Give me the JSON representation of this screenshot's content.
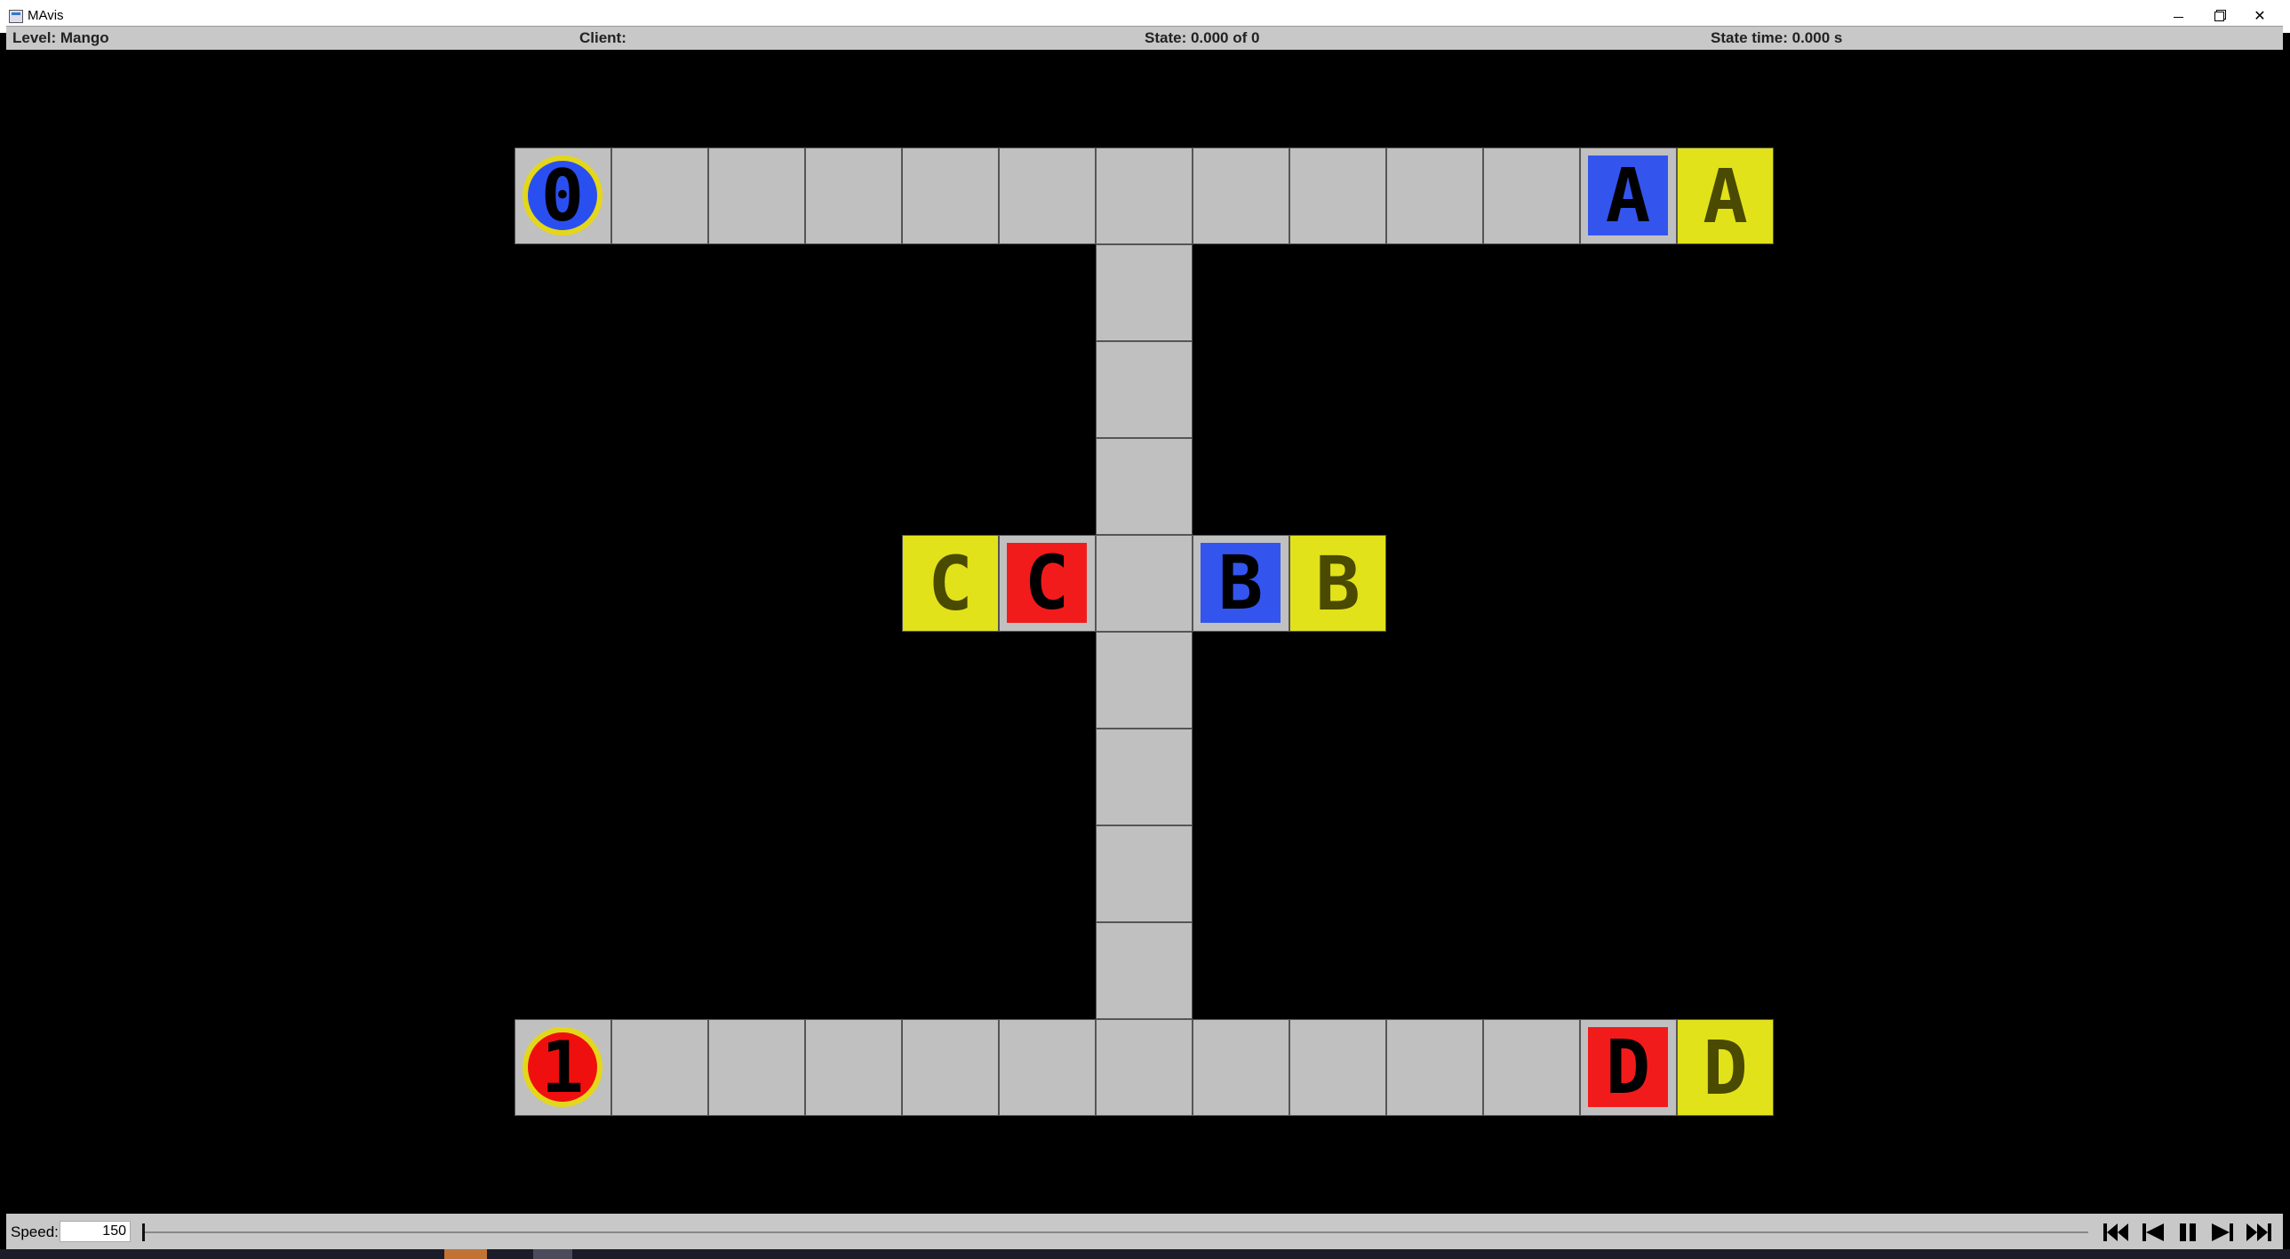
{
  "window": {
    "title": "MAvis"
  },
  "status": {
    "level": "Level: Mango",
    "client": "Client:",
    "state": "State: 0.000 of 0",
    "state_time": "State time: 0.000 s"
  },
  "board": {
    "agents": [
      {
        "label": "0",
        "color": "#2a4ff0"
      },
      {
        "label": "1",
        "color": "#f00f0f"
      }
    ],
    "boxes": [
      {
        "label": "A",
        "color": "#3355ee"
      },
      {
        "label": "B",
        "color": "#3355ee"
      },
      {
        "label": "C",
        "color": "#f21b1b"
      },
      {
        "label": "D",
        "color": "#f21b1b"
      }
    ],
    "goals": [
      "A",
      "B",
      "C",
      "D"
    ]
  },
  "controls": {
    "speed_label": "Speed:",
    "speed_value": "150",
    "timeline_position": 0
  },
  "icons": [
    "first-icon",
    "previous-icon",
    "pause-icon",
    "next-icon",
    "last-icon"
  ]
}
